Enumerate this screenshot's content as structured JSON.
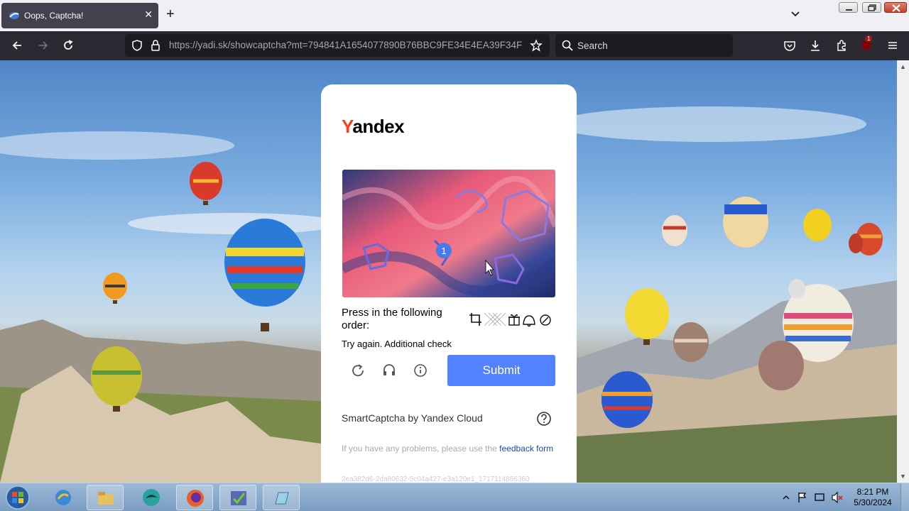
{
  "browser": {
    "tab_title": "Oops, Captcha!",
    "url_host": "https://yadi.sk",
    "url_path": "/showcaptcha?mt=794841A1654077890B76BBC9FE34E4EA39F34F",
    "search_placeholder": "Search",
    "extension_badge": "1"
  },
  "card": {
    "logo_y": "Y",
    "logo_rest": "andex",
    "image_badge": "1",
    "instruction": "Press in the following order:",
    "status": "Try again. Additional check",
    "submit_label": "Submit",
    "brand": "SmartCaptcha by Yandex Cloud",
    "feedback_prefix": "If you have any problems, please use the ",
    "feedback_link": "feedback form",
    "hash": "2ea382d6-2da80632-5c04a427-e3a120e1_1717114866360"
  },
  "taskbar": {
    "time": "8:21 PM",
    "date": "5/30/2024"
  },
  "colors": {
    "submit": "#5282ff",
    "yandex_red": "#fc3f1d",
    "link": "#1a4aa8"
  },
  "icons": [
    "firefox-tab-icon",
    "back-icon",
    "forward-icon",
    "reload-icon",
    "shield-icon",
    "lock-icon",
    "star-icon",
    "search-icon",
    "pocket-icon",
    "download-icon",
    "extensions-icon",
    "ublock-icon",
    "menu-icon",
    "refresh-captcha-icon",
    "audio-icon",
    "info-icon",
    "help-icon"
  ]
}
